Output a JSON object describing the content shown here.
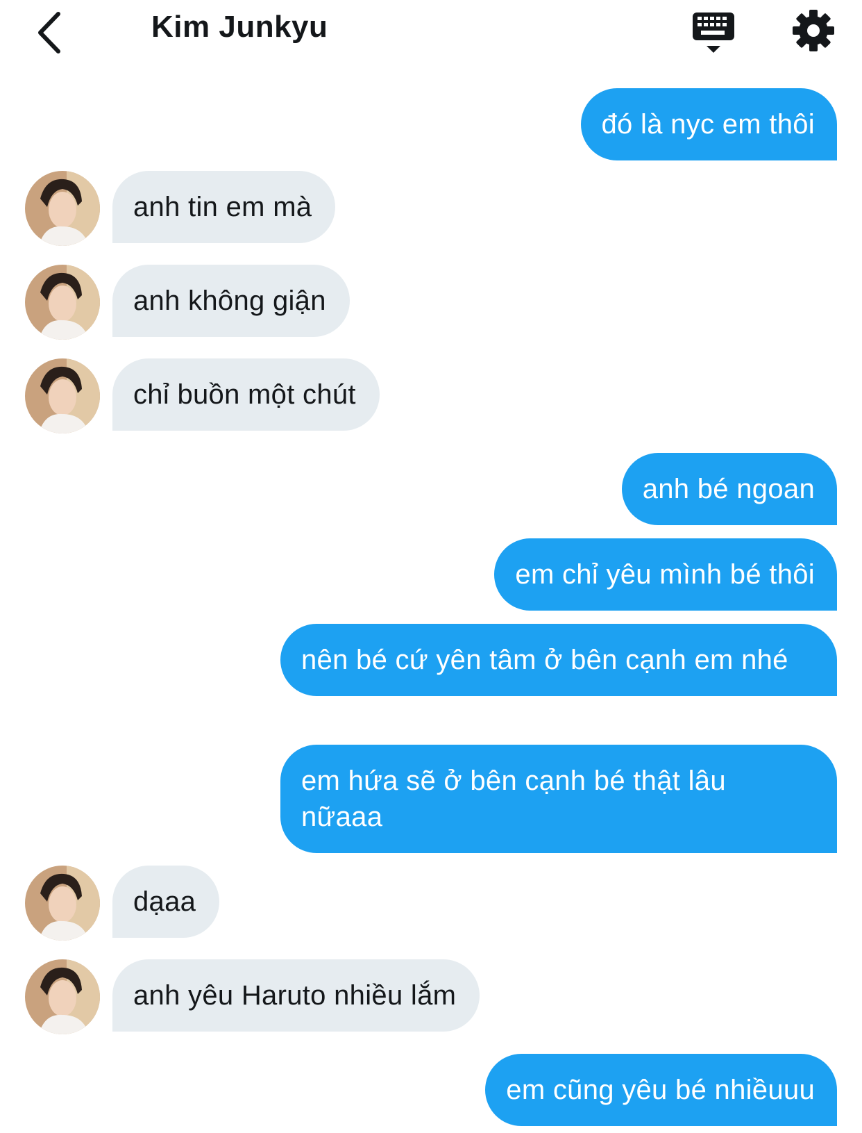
{
  "header": {
    "back_icon": "chevron-left-icon",
    "title": "Kim Junkyu",
    "keyboard_icon": "keyboard-dismiss-icon",
    "settings_icon": "gear-icon"
  },
  "colors": {
    "sent_bubble": "#1da1f2",
    "received_bubble": "#e6ecf0",
    "text_dark": "#14171a"
  },
  "messages": [
    {
      "side": "sent",
      "text": "đó là nyc em thôi"
    },
    {
      "side": "received",
      "text": "anh tin em mà"
    },
    {
      "side": "received",
      "text": "anh không giận"
    },
    {
      "side": "received",
      "text": "chỉ buồn một chút"
    },
    {
      "side": "sent",
      "text": "anh bé ngoan"
    },
    {
      "side": "sent",
      "text": "em chỉ yêu mình bé thôi"
    },
    {
      "side": "sent",
      "text": "nên bé cứ yên tâm ở bên cạnh em nhé"
    },
    {
      "side": "sent",
      "text": "em hứa sẽ ở bên cạnh bé thật lâu nữaaa"
    },
    {
      "side": "received",
      "text": "dạaa"
    },
    {
      "side": "received",
      "text": "anh yêu Haruto nhiều lắm"
    },
    {
      "side": "sent",
      "text": "em cũng yêu bé nhiềuuu"
    }
  ]
}
